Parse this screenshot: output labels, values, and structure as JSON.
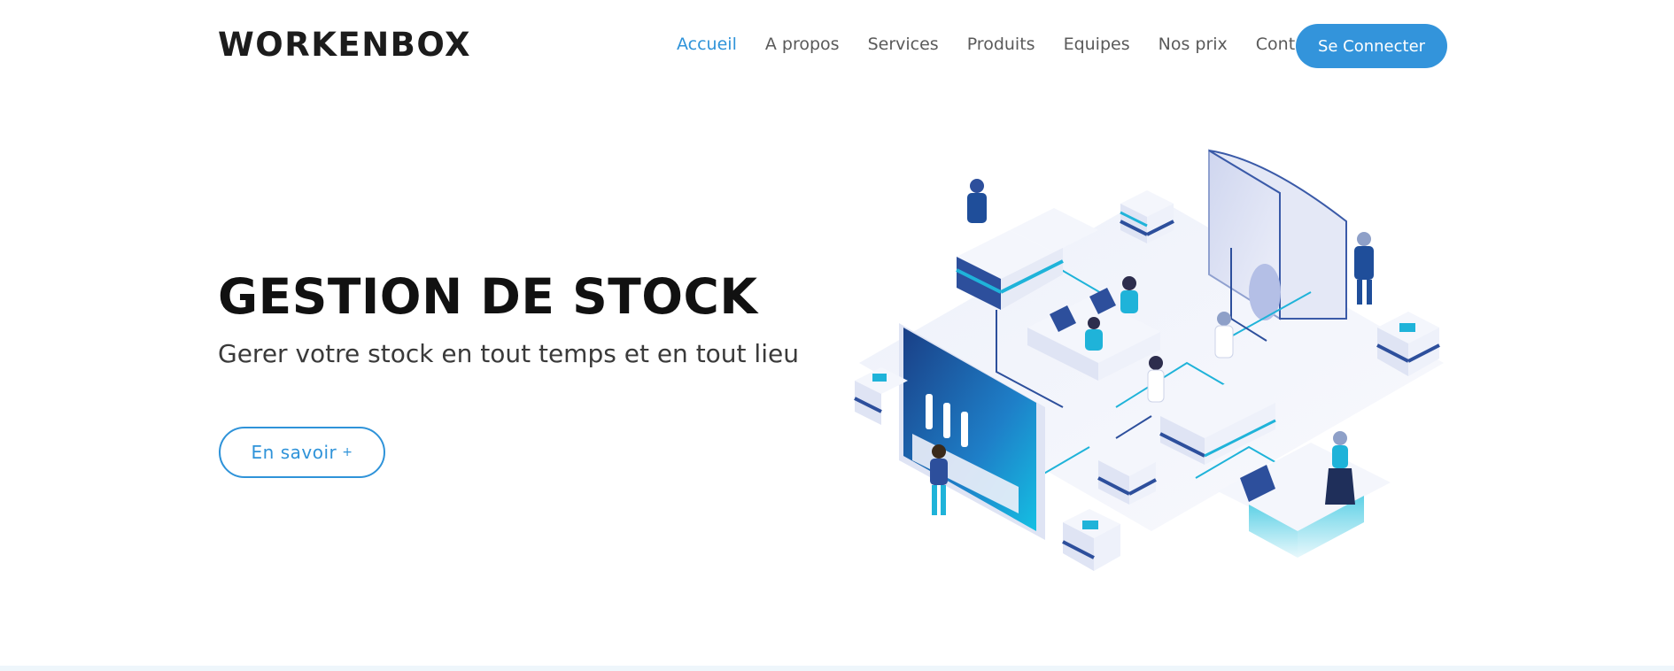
{
  "header": {
    "brand": "WORKENBOX",
    "nav": [
      "Accueil",
      "A propos",
      "Services",
      "Produits",
      "Equipes",
      "Nos prix",
      "Contact"
    ],
    "login_label": "Se Connecter"
  },
  "hero": {
    "title": "GESTION DE STOCK",
    "subtitle": "Gerer votre stock en tout temps et en tout lieu",
    "cta_label": "En savoir",
    "cta_plus": "+"
  },
  "colors": {
    "accent": "#2f93d9",
    "button": "#3394db",
    "text_dark": "#111111",
    "illustration_blue": "#1f4e9a",
    "illustration_cyan": "#1fb3d9"
  },
  "icons": {
    "illustration": "isometric-stock-management-illustration"
  }
}
